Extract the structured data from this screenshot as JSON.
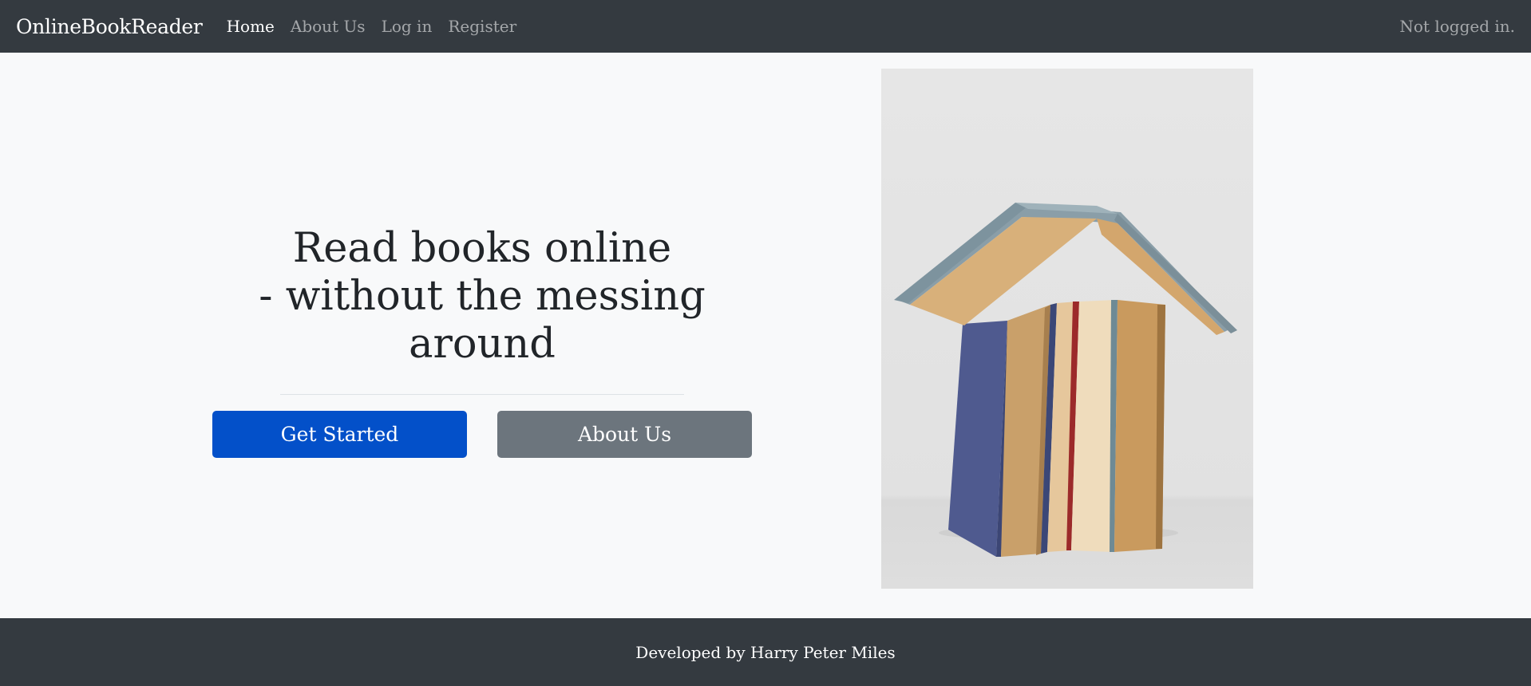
{
  "navbar": {
    "brand": "OnlineBookReader",
    "links": [
      {
        "label": "Home",
        "active": true
      },
      {
        "label": "About Us",
        "active": false
      },
      {
        "label": "Log in",
        "active": false
      },
      {
        "label": "Register",
        "active": false
      }
    ],
    "status": "Not logged in."
  },
  "hero": {
    "headline_line1": "Read books online",
    "headline_line2": "- without the messing",
    "headline_line3": "around",
    "get_started_label": "Get Started",
    "about_us_label": "About Us",
    "image_alt": "Stack of books forming a house shape"
  },
  "footer": {
    "text": "Developed by Harry Peter Miles"
  },
  "colors": {
    "navbar_bg": "#343a40",
    "page_bg": "#f8f9fa",
    "primary": "#0350c9",
    "secondary": "#6c757d"
  }
}
